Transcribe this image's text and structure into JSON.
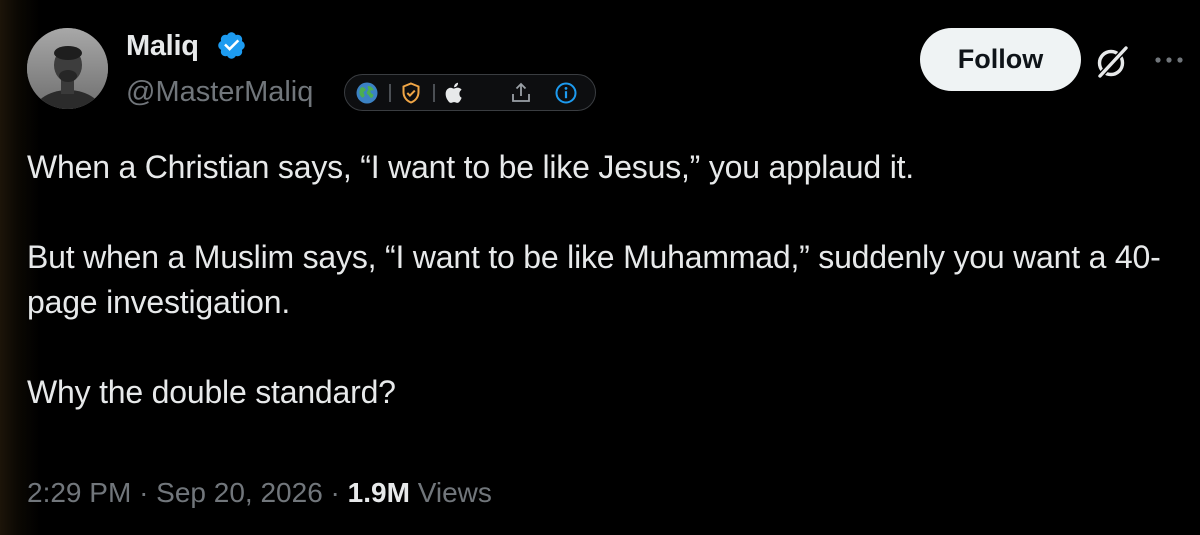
{
  "author": {
    "display_name": "Maliq",
    "handle": "@MasterMaliq",
    "verified": true,
    "verified_color": "#1d9bf0",
    "affiliation_icons": [
      "globe-icon",
      "shield-check-icon",
      "apple-icon",
      "share-icon",
      "info-icon"
    ]
  },
  "actions": {
    "follow_label": "Follow",
    "grok_icon": "grok-icon",
    "more_icon": "more-options-icon"
  },
  "tweet": {
    "paragraphs": [
      "When a Christian says, “I want to be like Jesus,” you applaud it.",
      "But when a Muslim says, “I want to be like Muhammad,” suddenly you want a 40-page investigation.",
      "Why the double standard?"
    ]
  },
  "meta": {
    "time": "2:29 PM",
    "separator": "·",
    "date": "Sep 20, 2026",
    "views_count": "1.9M",
    "views_label": "Views"
  },
  "colors": {
    "background": "#000000",
    "text_primary": "#e7e9ea",
    "text_secondary": "#71767b",
    "follow_bg": "#eff3f4",
    "shield_orange": "#f0a646",
    "info_blue": "#1d9bf0"
  }
}
